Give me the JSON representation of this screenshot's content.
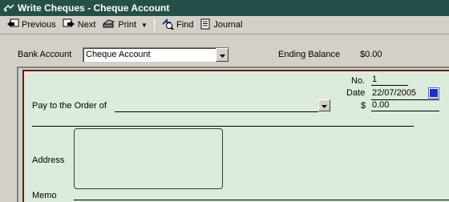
{
  "window": {
    "title": "Write Cheques - Cheque Account"
  },
  "toolbar": {
    "previous_label": "Previous",
    "next_label": "Next",
    "print_label": "Print",
    "find_label": "Find",
    "journal_label": "Journal"
  },
  "account_bar": {
    "bank_account_label": "Bank Account",
    "bank_account_value": "Cheque Account",
    "ending_balance_label": "Ending Balance",
    "ending_balance_value": "$0.00"
  },
  "cheque": {
    "no_label": "No.",
    "no_value": "1",
    "date_label": "Date",
    "date_value": "22/07/2005",
    "amount_label": "$",
    "amount_value": "0.00",
    "pay_to_label": "Pay to the Order of",
    "pay_to_value": "",
    "address_label": "Address",
    "address_value": "",
    "memo_label": "Memo",
    "memo_value": ""
  },
  "colors": {
    "titlebar_bg": "#24504a",
    "cheque_bg": "#dcebdc",
    "cheque_border": "#7a1212"
  },
  "icons": [
    "window-icon",
    "previous-icon",
    "next-icon",
    "print-icon",
    "find-icon",
    "journal-icon",
    "dropdown-arrow-icon",
    "calendar-icon"
  ]
}
